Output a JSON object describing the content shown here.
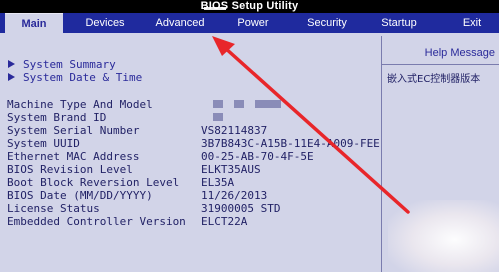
{
  "window": {
    "title": "BIOS Setup Utility"
  },
  "menu": {
    "tabs": [
      {
        "label": "Main",
        "active": true
      },
      {
        "label": "Devices",
        "active": false
      },
      {
        "label": "Advanced",
        "active": false
      },
      {
        "label": "Power",
        "active": false
      },
      {
        "label": "Security",
        "active": false
      },
      {
        "label": "Startup",
        "active": false
      },
      {
        "label": "Exit",
        "active": false
      }
    ]
  },
  "main": {
    "submenus": [
      {
        "label": "System Summary"
      },
      {
        "label": "System Date & Time"
      }
    ],
    "info_rows": [
      {
        "label": "Machine Type And Model",
        "value": ""
      },
      {
        "label": "System Brand ID",
        "value": ""
      },
      {
        "label": "System Serial Number",
        "value": "VS82114837"
      },
      {
        "label": "System UUID",
        "value": "3B7B843C-A15B-11E4-A009-FEE"
      },
      {
        "label": "Ethernet MAC Address",
        "value": "00-25-AB-70-4F-5E"
      },
      {
        "label": "BIOS Revision Level",
        "value": "ELKT35AUS"
      },
      {
        "label": "Boot Block Reversion Level",
        "value": "EL35A"
      },
      {
        "label": "BIOS Date (MM/DD/YYYY)",
        "value": "11/26/2013"
      },
      {
        "label": "License Status",
        "value": "31900005 STD"
      },
      {
        "label": "Embedded Controller Version",
        "value": "ELCT22A"
      }
    ]
  },
  "help": {
    "title": "Help Message",
    "text": "嵌入式EC控制器版本"
  },
  "colors": {
    "menubar": "#1f2a9e",
    "panel": "#d2d4e8",
    "text": "#222266",
    "annotation_arrow": "#e8262a"
  }
}
